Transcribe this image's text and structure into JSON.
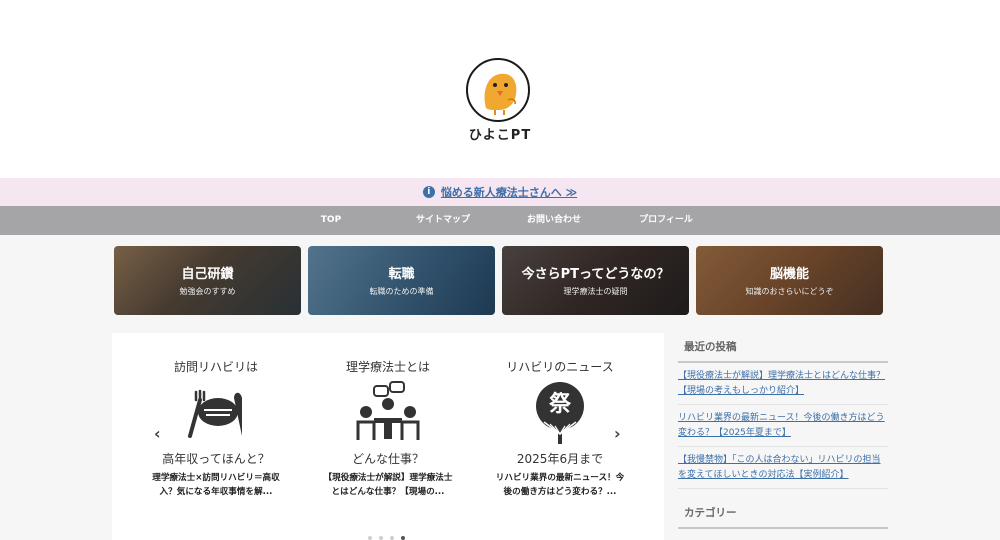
{
  "header": {
    "site_name": "ひよこPT",
    "logo_icon": "chick-icon"
  },
  "notice": {
    "icon": "info-icon",
    "text": "悩める新人療法士さんへ ≫"
  },
  "nav": {
    "items": [
      {
        "label": "TOP"
      },
      {
        "label": "サイトマップ"
      },
      {
        "label": "お問い合わせ"
      },
      {
        "label": "プロフィール"
      }
    ]
  },
  "categories": [
    {
      "title": "自己研鑽",
      "subtitle": "勉強会のすすめ"
    },
    {
      "title": "転職",
      "subtitle": "転職のための準備"
    },
    {
      "title": "今さらPTってどうなの？",
      "subtitle": "理学療法士の疑問"
    },
    {
      "title": "脳機能",
      "subtitle": "知識のおさらいにどうぞ"
    }
  ],
  "carousel": {
    "prev_icon": "chevron-left-icon",
    "next_icon": "chevron-right-icon",
    "slides": [
      {
        "heading": "訪問リハビリは",
        "tagline": "高年収ってほんと？",
        "icon": "steak-icon",
        "text": "理学療法士×訪問リハビリ＝高収入？気になる年収事情を解..."
      },
      {
        "heading": "理学療法士とは",
        "tagline": "どんな仕事？",
        "icon": "meeting-icon",
        "text": "【現役療法士が解説】理学療法士とはどんな仕事？【現場の..."
      },
      {
        "heading": "リハビリのニュース",
        "tagline": "2025年6月まで",
        "icon": "festival-fan-icon",
        "fan_text": "祭",
        "text": "リハビリ業界の最新ニュース！今後の働き方はどう変わる？..."
      }
    ],
    "dots": 4,
    "active_dot": 4
  },
  "sidebar": {
    "recent_heading": "最近の投稿",
    "posts": [
      "【現役療法士が解説】理学療法士とはどんな仕事？【現場の考えもしっかり紹介】",
      "リハビリ業界の最新ニュース！今後の働き方はどう変わる？【2025年夏まで】",
      "【我慢禁物】「この人は合わない」リハビリの担当を変えてほしいときの対応法【実例紹介】"
    ],
    "category_heading": "カテゴリー"
  },
  "colors": {
    "link": "#3d6fa8",
    "nav_bg": "#a5a5a8",
    "notice_bg": "#f5e6f1",
    "chick": "#f0a830"
  }
}
